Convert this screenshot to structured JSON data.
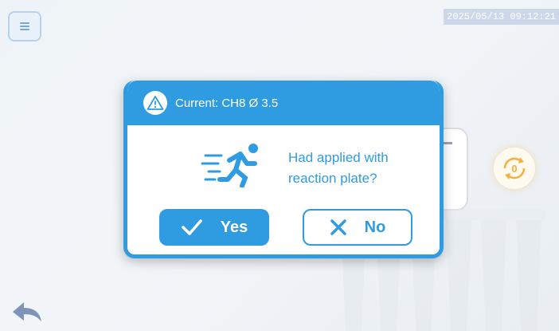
{
  "topbar": {
    "timestamp": "2025/05/13  09:12:21"
  },
  "background": {
    "counter_value": "0"
  },
  "dialog": {
    "title": "Current: CH8 Ø 3.5",
    "message_line1": "Had applied with",
    "message_line2": "reaction plate?",
    "yes_label": "Yes",
    "no_label": "No"
  },
  "colors": {
    "accent": "#2f9be0",
    "counter": "#f6b03c"
  },
  "icons": [
    "menu-icon",
    "warning-icon",
    "running-person-icon",
    "check-icon",
    "close-icon",
    "refresh-counter-icon",
    "back-arrow-icon"
  ]
}
